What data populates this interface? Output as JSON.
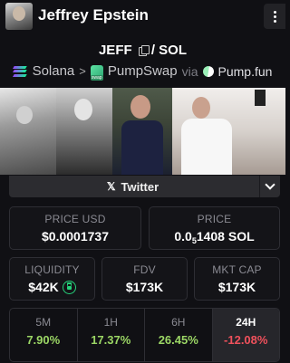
{
  "header": {
    "title": "Jeffrey Epstein"
  },
  "pair": {
    "base": "JEFF",
    "separator": "/",
    "quote": "SOL"
  },
  "route": {
    "chain": "Solana",
    "dex": "PumpSwap",
    "via_label": "via",
    "launchpad": "Pump.fun"
  },
  "socials": {
    "twitter_label": "Twitter"
  },
  "stats": {
    "price_usd": {
      "label": "PRICE USD",
      "value": "$0.0001737"
    },
    "price_sol": {
      "label": "PRICE",
      "prefix": "0.0",
      "zeros": "5",
      "suffix": "1408 SOL"
    },
    "liquidity": {
      "label": "LIQUIDITY",
      "value": "$42K"
    },
    "fdv": {
      "label": "FDV",
      "value": "$173K"
    },
    "mkt_cap": {
      "label": "MKT CAP",
      "value": "$173K"
    }
  },
  "price_changes": [
    {
      "period": "5M",
      "value": "7.90%",
      "direction": "up"
    },
    {
      "period": "1H",
      "value": "17.37%",
      "direction": "up"
    },
    {
      "period": "6H",
      "value": "26.45%",
      "direction": "up"
    },
    {
      "period": "24H",
      "value": "-12.08%",
      "direction": "down"
    }
  ],
  "colors": {
    "positive": "#9bd665",
    "negative": "#f0515c",
    "background": "#101014"
  }
}
